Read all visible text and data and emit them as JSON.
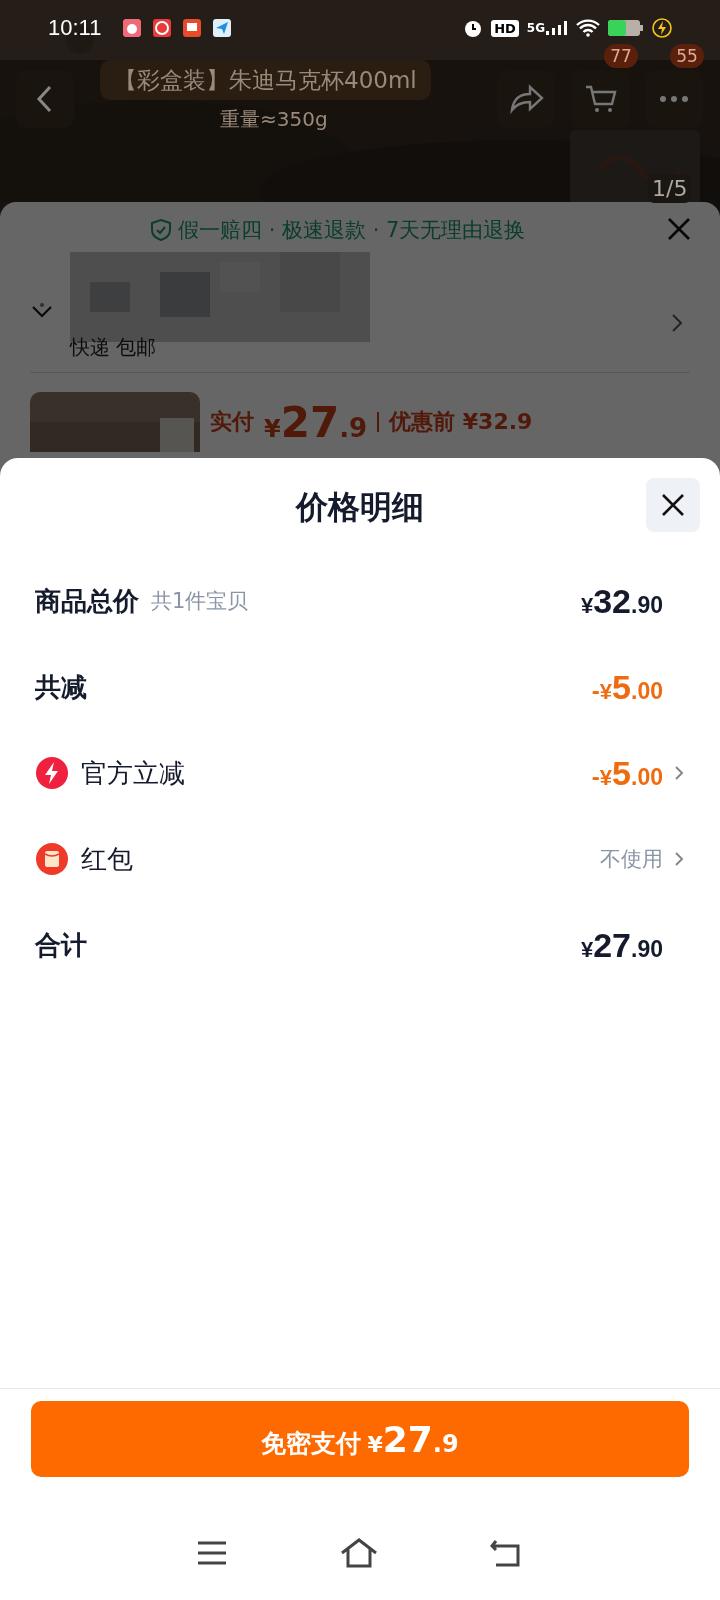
{
  "status_bar": {
    "time": "10:11",
    "network": "5G",
    "hd": "HD"
  },
  "product_page": {
    "title": "【彩盒装】朱迪马克杯400ml",
    "subtitle": "重量≈350g",
    "cart_badge": "77",
    "more_badge": "55",
    "image_counter": "1/5"
  },
  "order_sheet": {
    "guarantee": "假一赔四 · 极速退款 · 7天无理由退换",
    "shipping": "快递 包邮",
    "pay_label": "实付",
    "pay_currency": "¥",
    "pay_integer": "27",
    "pay_decimal": ".9",
    "before_label": "优惠前",
    "before_price": "¥32.9"
  },
  "price_detail": {
    "title": "价格明细",
    "rows": [
      {
        "kind": "total",
        "label": "商品总价",
        "note": "共1件宝贝",
        "sign": "",
        "currency": "¥",
        "integer": "32",
        "decimal": ".90",
        "discount": false,
        "link": false
      },
      {
        "kind": "plain",
        "label": "共减",
        "sign": "-",
        "currency": "¥",
        "integer": "5",
        "decimal": ".00",
        "discount": true,
        "link": false
      },
      {
        "kind": "bolt",
        "label": "官方立减",
        "sign": "-",
        "currency": "¥",
        "integer": "5",
        "decimal": ".00",
        "discount": true,
        "link": true
      },
      {
        "kind": "envelope",
        "label": "红包",
        "value": "不使用",
        "link": true
      },
      {
        "kind": "plain",
        "label": "合计",
        "sign": "",
        "currency": "¥",
        "integer": "27",
        "decimal": ".90",
        "discount": false,
        "link": false
      }
    ]
  },
  "pay_button": {
    "label": "免密支付",
    "currency": "¥",
    "integer": "27",
    "decimal": ".9"
  }
}
